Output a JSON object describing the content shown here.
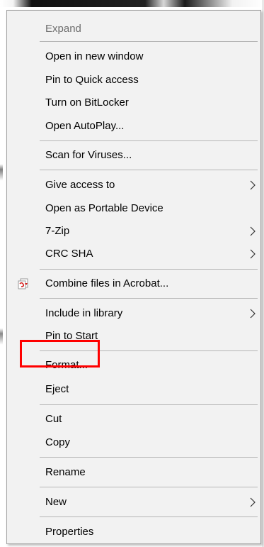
{
  "menu": {
    "items": [
      {
        "label": "Expand",
        "disabled": true
      },
      {
        "label": "Open in new window"
      },
      {
        "label": "Pin to Quick access"
      },
      {
        "label": "Turn on BitLocker"
      },
      {
        "label": "Open AutoPlay..."
      },
      {
        "label": "Scan for Viruses..."
      },
      {
        "label": "Give access to",
        "submenu": true
      },
      {
        "label": "Open as Portable Device"
      },
      {
        "label": "7-Zip",
        "submenu": true
      },
      {
        "label": "CRC SHA",
        "submenu": true
      },
      {
        "label": "Combine files in Acrobat...",
        "icon": "acrobat-combine-icon"
      },
      {
        "label": "Include in library",
        "submenu": true
      },
      {
        "label": "Pin to Start"
      },
      {
        "label": "Format...",
        "highlighted": true
      },
      {
        "label": "Eject"
      },
      {
        "label": "Cut"
      },
      {
        "label": "Copy"
      },
      {
        "label": "Rename"
      },
      {
        "label": "New",
        "submenu": true
      },
      {
        "label": "Properties"
      }
    ]
  },
  "annotation": {
    "highlight_color": "#ff0000",
    "highlighted_item": "Format..."
  },
  "colors": {
    "menu_background": "#f2f2f2",
    "separator": "#b6b6b6",
    "disabled_text": "#6d6d6d"
  }
}
